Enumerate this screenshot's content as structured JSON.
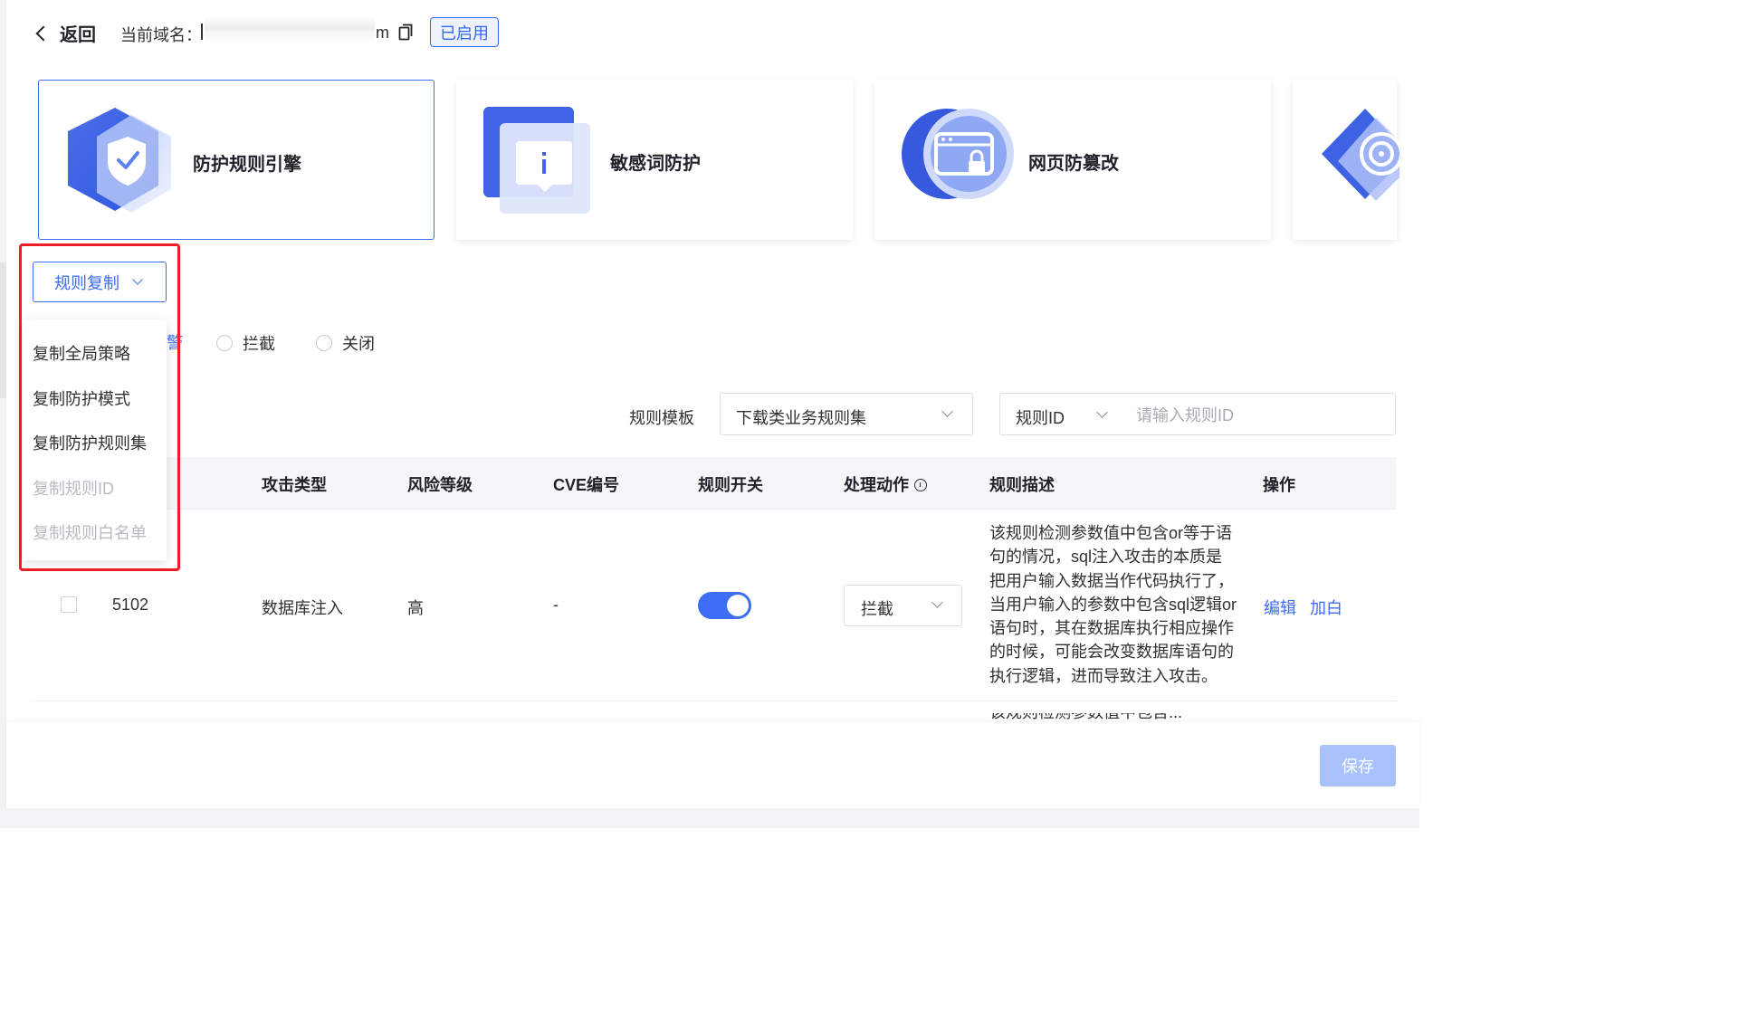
{
  "header": {
    "back_label": "返回",
    "domain_label": "当前域名：",
    "domain_tail": "m",
    "status_badge": "已启用"
  },
  "feature_cards": [
    {
      "label": "防护规则引擎",
      "icon": "shield-check-icon",
      "active": true
    },
    {
      "label": "敏感词防护",
      "icon": "info-message-icon",
      "active": false
    },
    {
      "label": "网页防篡改",
      "icon": "browser-lock-icon",
      "active": false
    },
    {
      "label": "",
      "icon": "target-icon",
      "active": false
    }
  ],
  "copy_dropdown": {
    "trigger_label": "规则复制",
    "items": [
      {
        "label": "复制全局策略",
        "disabled": false
      },
      {
        "label": "复制防护模式",
        "disabled": false
      },
      {
        "label": "复制防护规则集",
        "disabled": false
      },
      {
        "label": "复制规则ID",
        "disabled": true
      },
      {
        "label": "复制规则白名单",
        "disabled": true
      }
    ]
  },
  "mode": {
    "peek_text": "警",
    "options": [
      "拦截",
      "关闭"
    ]
  },
  "filters": {
    "template_label": "规则模板",
    "template_value": "下载类业务规则集",
    "search_type": "规则ID",
    "search_placeholder": "请输入规则ID"
  },
  "table": {
    "columns": [
      "攻击类型",
      "风险等级",
      "CVE编号",
      "规则开关",
      "处理动作",
      "规则描述",
      "操作"
    ],
    "rows": [
      {
        "id": "5102",
        "attack_type": "数据库注入",
        "risk": "高",
        "cve": "-",
        "enabled": true,
        "action": "拦截",
        "description": "该规则检测参数值中包含or等于语句的情况，sql注入攻击的本质是把用户输入数据当作代码执行了，当用户输入的参数中包含sql逻辑or语句时，其在数据库执行相应操作的时候，可能会改变数据库语句的执行逻辑，进而导致注入攻击。",
        "ops": [
          "编辑",
          "加白"
        ]
      }
    ],
    "next_row_peek": "该规则检测参数值中包含..."
  },
  "footer": {
    "save_label": "保存"
  },
  "colors": {
    "primary": "#3d6cf5",
    "highlight_box": "#ee1c25",
    "save_disabled": "#a9c2fb"
  }
}
